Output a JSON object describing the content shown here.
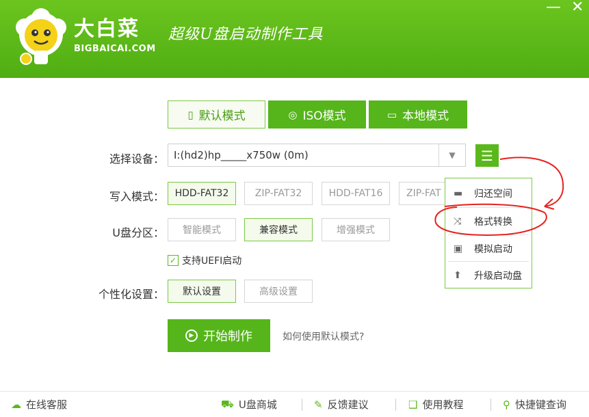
{
  "header": {
    "brand_cn": "大白菜",
    "brand_en": "BIGBAICAI.COM",
    "slogan": "超级U盘启动制作工具",
    "minimize": "—",
    "close": "✕"
  },
  "tabs": [
    {
      "label": "默认模式",
      "icon": "usb-drive-icon",
      "active": true
    },
    {
      "label": "ISO模式",
      "icon": "disc-icon",
      "active": false
    },
    {
      "label": "本地模式",
      "icon": "monitor-icon",
      "active": false
    }
  ],
  "device": {
    "label": "选择设备：",
    "value": "I:(hd2)hp_____x750w (0m)"
  },
  "write_mode": {
    "label": "写入模式：",
    "options": [
      "HDD-FAT32",
      "ZIP-FAT32",
      "HDD-FAT16",
      "ZIP-FAT"
    ],
    "selected": "HDD-FAT32"
  },
  "partition": {
    "label": "U盘分区：",
    "options": [
      "智能模式",
      "兼容模式",
      "增强模式"
    ],
    "selected": "兼容模式"
  },
  "uefi": {
    "label": "支持UEFI启动",
    "checked": true
  },
  "personal": {
    "label": "个性化设置：",
    "options": [
      "默认设置",
      "高级设置"
    ],
    "selected": "默认设置"
  },
  "start": {
    "label": "开始制作",
    "howto": "如何使用默认模式?"
  },
  "menu": {
    "items": [
      {
        "label": "归还空间",
        "icon": "drive-icon"
      },
      {
        "label": "格式转换",
        "icon": "shuffle-icon"
      },
      {
        "label": "模拟启动",
        "icon": "monitor-play-icon"
      },
      {
        "label": "升级启动盘",
        "icon": "upload-icon"
      }
    ]
  },
  "footer": {
    "service": "在线客服",
    "shop": "U盘商城",
    "feedback": "反馈建议",
    "tutorial": "使用教程",
    "shortcut": "快捷键查询"
  },
  "colors": {
    "accent": "#55b51a",
    "header_top": "#6cc51f",
    "annotation": "#e8211e"
  }
}
